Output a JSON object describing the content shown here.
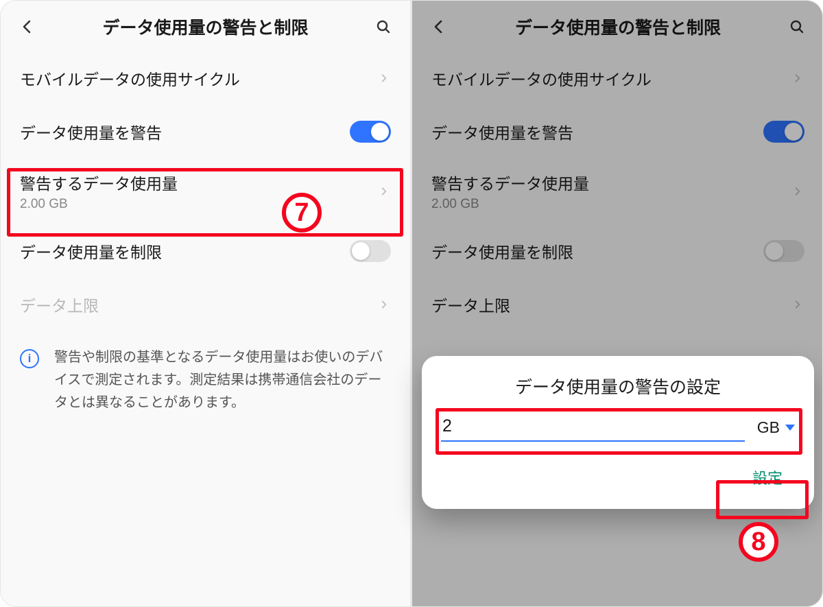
{
  "header": {
    "title": "データ使用量の警告と制限"
  },
  "rows": {
    "cycle": {
      "title": "モバイルデータの使用サイクル"
    },
    "warn_toggle": {
      "title": "データ使用量を警告"
    },
    "warn_amount": {
      "title": "警告するデータ使用量",
      "sub": "2.00 GB"
    },
    "limit_toggle": {
      "title": "データ使用量を制限"
    },
    "limit_amount": {
      "title": "データ上限"
    }
  },
  "info": {
    "text": "警告や制限の基準となるデータ使用量はお使いのデバイスで測定されます。測定結果は携帯通信会社のデータとは異なることがあります。"
  },
  "dialog": {
    "title": "データ使用量の警告の設定",
    "value": "2",
    "unit": "GB",
    "action": "設定"
  },
  "callouts": {
    "seven": "7",
    "eight": "8"
  },
  "icons": {
    "info_glyph": "i"
  }
}
